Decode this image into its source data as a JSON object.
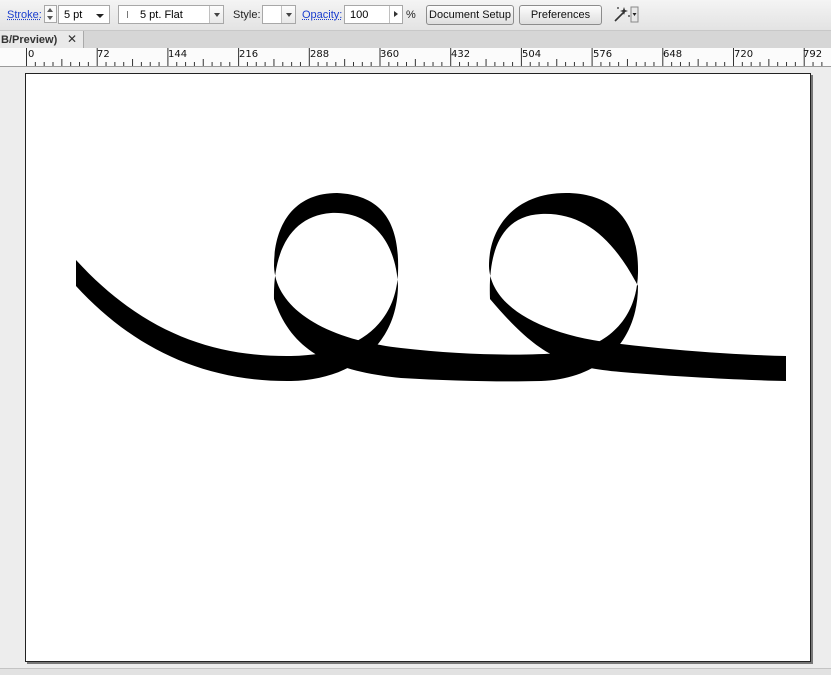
{
  "control_bar": {
    "stroke_label": "Stroke:",
    "stroke_value": "5 pt",
    "brush_value": "5 pt. Flat",
    "style_label": "Style:",
    "opacity_label": "Opacity:",
    "opacity_value": "100",
    "opacity_unit": "%",
    "document_setup_label": "Document Setup",
    "preferences_label": "Preferences",
    "link_color": "#1a3ecf"
  },
  "document_tab": {
    "title": "B/Preview)",
    "close_glyph": "✕"
  },
  "ruler": {
    "labels": [
      "0",
      "72",
      "144",
      "216",
      "288",
      "360",
      "432",
      "504",
      "576",
      "648",
      "720",
      "792"
    ]
  },
  "artwork": {
    "stroke_color": "#000000",
    "fill_color": "#ffffff"
  },
  "icons": {
    "stroke_stepper": "stepper-icon",
    "dropdown": "chevron-down-icon",
    "opacity_arrow": "play-right-icon",
    "isolate": "magic-wand-icon",
    "close": "close-icon"
  }
}
